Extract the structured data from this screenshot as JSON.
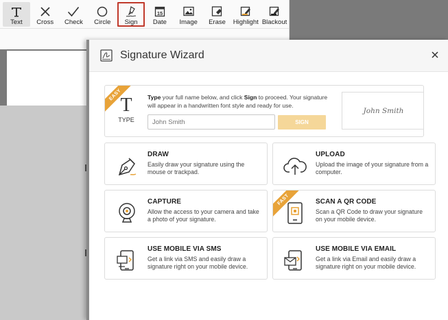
{
  "toolbar": {
    "tools": [
      {
        "label": "Text",
        "icon": "text-icon"
      },
      {
        "label": "Cross",
        "icon": "cross-icon"
      },
      {
        "label": "Check",
        "icon": "check-icon"
      },
      {
        "label": "Circle",
        "icon": "circle-icon"
      },
      {
        "label": "Sign",
        "icon": "sign-pen-icon"
      },
      {
        "label": "Date",
        "icon": "calendar-icon"
      },
      {
        "label": "Image",
        "icon": "image-icon"
      },
      {
        "label": "Erase",
        "icon": "eraser-icon"
      },
      {
        "label": "Highlight",
        "icon": "highlight-icon"
      },
      {
        "label": "Blackout",
        "icon": "blackout-icon"
      }
    ],
    "selected": "Sign",
    "calendar_day": "15"
  },
  "modal": {
    "title": "Signature Wizard",
    "type_card": {
      "badge": "EASY",
      "icon_letter": "T",
      "label": "TYPE",
      "instr_1": "Type",
      "instr_2": " your full name below, and click ",
      "instr_3": "Sign",
      "instr_4": " to proceed. Your signature will appear in a handwritten font style and ready for use.",
      "placeholder": "John Smith",
      "button": "SIGN",
      "preview": "John Smith"
    },
    "options": [
      {
        "title": "DRAW",
        "desc": "Easily draw your signature using the mouse or trackpad."
      },
      {
        "title": "UPLOAD",
        "desc": "Upload the image of your signature from a computer."
      },
      {
        "title": "CAPTURE",
        "desc": "Allow the access to your camera and take a photo of your signature."
      },
      {
        "title": "SCAN A QR CODE",
        "desc": "Scan a QR Code to draw your signature on your mobile device.",
        "badge": "FAST"
      },
      {
        "title": "USE MOBILE VIA SMS",
        "desc": "Get a link via SMS and easily draw a signature right on your mobile device."
      },
      {
        "title": "USE MOBILE VIA EMAIL",
        "desc": "Get a link via Email and easily draw a signature right on your mobile device."
      }
    ]
  },
  "colors": {
    "accent": "#e8a339",
    "sign_button": "#f5d799",
    "selected_border": "#c0392b"
  }
}
